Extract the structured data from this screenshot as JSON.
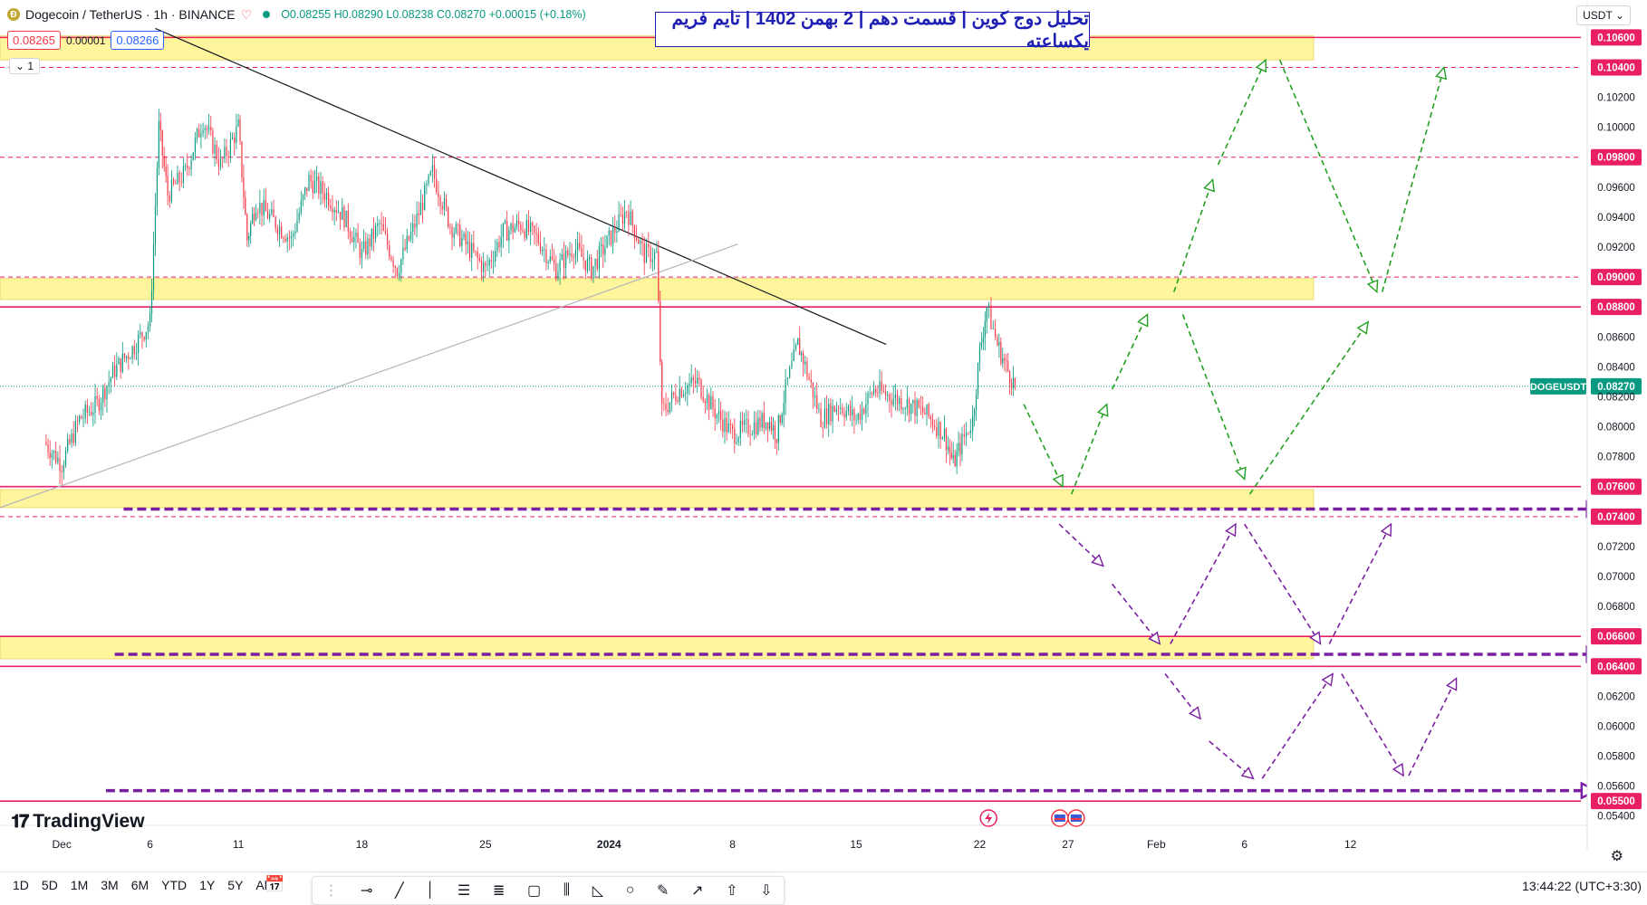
{
  "header": {
    "symbol": "Dogecoin / TetherUS · 1h · BINANCE",
    "open": "O0.08255",
    "high": "H0.08290",
    "low": "L0.08238",
    "close": "C0.08270",
    "change": "+0.00015 (+0.18%)"
  },
  "prices": {
    "bid": "0.08265",
    "spread": "0.00001",
    "ask": "0.08266"
  },
  "indicator_count": "1",
  "annotation_title": "تحلیل دوج کوین | قسمت دهم | 2 بهمن 1402 | تایم فریم یکساعته",
  "currency": "USDT",
  "brand": "TradingView",
  "timeframes": [
    "1D",
    "5D",
    "1M",
    "3M",
    "6M",
    "YTD",
    "1Y",
    "5Y",
    "All"
  ],
  "clock": "13:44:22 (UTC+3:30)",
  "colors": {
    "up": "#089981",
    "down": "#f23645",
    "level": "#e91e63",
    "zone": "#fff59d",
    "green_path": "#22a022",
    "purple_path": "#7b1fa2",
    "title_blue": "#1f1fb4"
  },
  "chart_data": {
    "type": "candlestick",
    "symbol_label": "DOGEUSDT",
    "last_price": 0.0827,
    "y_range": [
      0.0535,
      0.1085
    ],
    "y_ticks": [
      "0.10600",
      "0.10400",
      "0.10200",
      "0.10000",
      "0.09800",
      "0.09600",
      "0.09400",
      "0.09200",
      "0.09000",
      "0.08800",
      "0.08600",
      "0.08400",
      "0.08270",
      "0.08200",
      "0.08000",
      "0.07800",
      "0.07600",
      "0.07400",
      "0.07200",
      "0.07000",
      "0.06800",
      "0.06600",
      "0.06400",
      "0.06200",
      "0.06000",
      "0.05800",
      "0.05600",
      "0.05500",
      "0.05400"
    ],
    "highlighted_ticks": [
      "0.10600",
      "0.10400",
      "0.09800",
      "0.09000",
      "0.08800",
      "0.07600",
      "0.07400",
      "0.06600",
      "0.06400",
      "0.05500"
    ],
    "x_ticks": [
      {
        "label": "Dec",
        "day": 1
      },
      {
        "label": "6",
        "day": 6
      },
      {
        "label": "11",
        "day": 11
      },
      {
        "label": "18",
        "day": 18
      },
      {
        "label": "25",
        "day": 25
      },
      {
        "label": "2024",
        "day": 32
      },
      {
        "label": "8",
        "day": 39
      },
      {
        "label": "15",
        "day": 46
      },
      {
        "label": "22",
        "day": 53
      },
      {
        "label": "27",
        "day": 58
      },
      {
        "label": "Feb",
        "day": 63
      },
      {
        "label": "6",
        "day": 68
      },
      {
        "label": "12",
        "day": 74
      }
    ],
    "x_range_days": [
      -2.5,
      90.8
    ],
    "solid_levels": [
      0.106,
      0.088,
      0.076,
      0.066,
      0.064,
      0.055
    ],
    "dashed_levels": [
      0.104,
      0.098,
      0.09,
      0.074
    ],
    "zones": [
      {
        "from": 0.1045,
        "to": 0.1061
      },
      {
        "from": 0.0885,
        "to": 0.0899
      },
      {
        "from": 0.0746,
        "to": 0.0758
      },
      {
        "from": 0.0645,
        "to": 0.066
      }
    ],
    "trendlines": [
      {
        "from": [
          6.3,
          0.1066
        ],
        "to": [
          47.7,
          0.0855
        ],
        "color": "#131722"
      },
      {
        "from": [
          -2.5,
          0.0746
        ],
        "to": [
          39.3,
          0.0922
        ],
        "color": "#b2b5be"
      }
    ],
    "candle_anchors": [
      [
        0,
        0.079
      ],
      [
        1,
        0.0775
      ],
      [
        2,
        0.0805
      ],
      [
        3,
        0.0815
      ],
      [
        4,
        0.0838
      ],
      [
        5,
        0.0852
      ],
      [
        6,
        0.087
      ],
      [
        6.5,
        0.1
      ],
      [
        7,
        0.0955
      ],
      [
        8,
        0.097
      ],
      [
        9,
        0.1005
      ],
      [
        10,
        0.0975
      ],
      [
        11,
        0.1
      ],
      [
        11.5,
        0.0925
      ],
      [
        12,
        0.095
      ],
      [
        14,
        0.0925
      ],
      [
        15,
        0.0965
      ],
      [
        16,
        0.0955
      ],
      [
        17,
        0.094
      ],
      [
        18,
        0.0915
      ],
      [
        19,
        0.0935
      ],
      [
        20,
        0.0905
      ],
      [
        21,
        0.0935
      ],
      [
        22,
        0.097
      ],
      [
        23,
        0.0935
      ],
      [
        24,
        0.092
      ],
      [
        25,
        0.0905
      ],
      [
        26,
        0.093
      ],
      [
        27,
        0.0935
      ],
      [
        28,
        0.0925
      ],
      [
        29,
        0.0905
      ],
      [
        30,
        0.092
      ],
      [
        31,
        0.0905
      ],
      [
        32,
        0.0925
      ],
      [
        33,
        0.0945
      ],
      [
        34,
        0.0915
      ],
      [
        34.7,
        0.0915
      ],
      [
        35,
        0.081
      ],
      [
        36,
        0.0825
      ],
      [
        37,
        0.083
      ],
      [
        38,
        0.081
      ],
      [
        39,
        0.0795
      ],
      [
        40,
        0.08
      ],
      [
        41,
        0.0805
      ],
      [
        41.5,
        0.0795
      ],
      [
        42,
        0.0825
      ],
      [
        42.7,
        0.0855
      ],
      [
        43,
        0.0845
      ],
      [
        44,
        0.0805
      ],
      [
        45,
        0.0815
      ],
      [
        46,
        0.0805
      ],
      [
        47,
        0.0825
      ],
      [
        48,
        0.082
      ],
      [
        49,
        0.0815
      ],
      [
        50,
        0.0808
      ],
      [
        51,
        0.0795
      ],
      [
        51.5,
        0.0775
      ],
      [
        52,
        0.079
      ],
      [
        52.6,
        0.0805
      ],
      [
        53,
        0.085
      ],
      [
        53.4,
        0.088
      ],
      [
        54,
        0.0855
      ],
      [
        54.5,
        0.084
      ],
      [
        55,
        0.0827
      ]
    ],
    "projections": {
      "green": [
        [
          [
            55.5,
            0.0815
          ],
          [
            57.7,
            0.076
          ]
        ],
        [
          [
            58.2,
            0.0755
          ],
          [
            60.2,
            0.0815
          ]
        ],
        [
          [
            60.5,
            0.0825
          ],
          [
            62.5,
            0.0875
          ]
        ],
        [
          [
            64,
            0.089
          ],
          [
            66.2,
            0.0965
          ]
        ],
        [
          [
            66.5,
            0.0975
          ],
          [
            69.2,
            0.1045
          ]
        ],
        [
          [
            69.5,
            0.1092
          ],
          [
            70.5,
            0.1115
          ]
        ],
        [
          [
            70,
            0.1045
          ],
          [
            75.5,
            0.089
          ]
        ],
        [
          [
            75.8,
            0.089
          ],
          [
            79.3,
            0.104
          ]
        ],
        [
          [
            64.5,
            0.0875
          ],
          [
            68,
            0.0765
          ]
        ],
        [
          [
            68.3,
            0.0755
          ],
          [
            75,
            0.087
          ]
        ]
      ],
      "purple": [
        [
          [
            57.5,
            0.0735
          ],
          [
            60,
            0.0707
          ]
        ],
        [
          [
            60.5,
            0.0695
          ],
          [
            63.2,
            0.0655
          ]
        ],
        [
          [
            63.8,
            0.0655
          ],
          [
            67.5,
            0.0735
          ]
        ],
        [
          [
            68,
            0.0735
          ],
          [
            72.3,
            0.0655
          ]
        ],
        [
          [
            72.8,
            0.0655
          ],
          [
            76.3,
            0.0735
          ]
        ],
        [
          [
            63.5,
            0.0635
          ],
          [
            65.5,
            0.0605
          ]
        ],
        [
          [
            66,
            0.059
          ],
          [
            68.5,
            0.0565
          ]
        ],
        [
          [
            69,
            0.0565
          ],
          [
            73,
            0.0635
          ]
        ],
        [
          [
            73.5,
            0.0635
          ],
          [
            77,
            0.0567
          ]
        ],
        [
          [
            77.3,
            0.0567
          ],
          [
            80,
            0.0632
          ]
        ]
      ],
      "purple_levels": [
        {
          "price": 0.0745,
          "from": 4.5,
          "to": 87.5
        },
        {
          "price": 0.0648,
          "from": 4,
          "to": 87.5
        },
        {
          "price": 0.0557,
          "from": 3.5,
          "to": 87.2
        }
      ]
    },
    "event_markers": [
      {
        "day": 53.5,
        "type": "flash"
      },
      {
        "day": 58,
        "type": "flag"
      }
    ]
  }
}
